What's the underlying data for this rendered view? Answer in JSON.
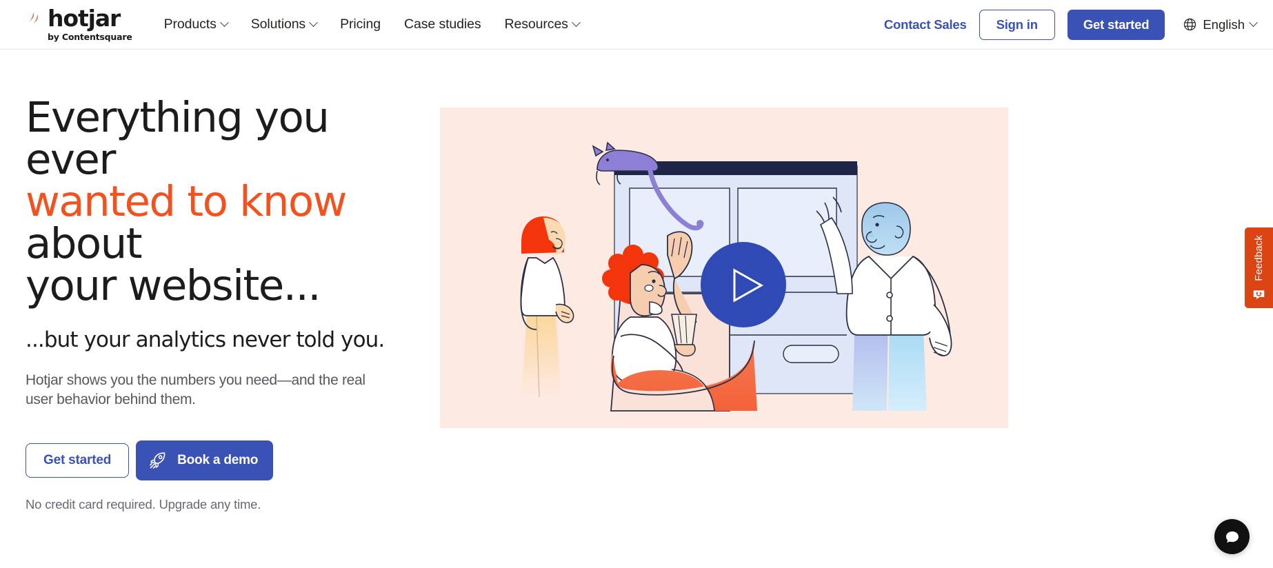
{
  "header": {
    "logo": {
      "icon": "hotjar-flame-icon",
      "wordmark": "hotjar",
      "byline": "by Contentsquare"
    },
    "nav": [
      {
        "label": "Products",
        "has_caret": true,
        "icon": "chevron-down-icon"
      },
      {
        "label": "Solutions",
        "has_caret": true,
        "icon": "chevron-down-icon"
      },
      {
        "label": "Pricing",
        "has_caret": false
      },
      {
        "label": "Case studies",
        "has_caret": false
      },
      {
        "label": "Resources",
        "has_caret": true,
        "icon": "chevron-down-icon"
      }
    ],
    "contact_sales": "Contact Sales",
    "sign_in": "Sign in",
    "get_started": "Get started",
    "language": {
      "label": "English",
      "globe_icon": "globe-icon",
      "caret_icon": "chevron-down-icon"
    }
  },
  "hero": {
    "headline_line1": "Everything you ever",
    "headline_accent": "wanted to know",
    "headline_line2_rest": " about",
    "headline_line3": "your website...",
    "subheadline": "...but your analytics never told you.",
    "body": "Hotjar shows you the numbers you need—and the real user behavior behind them.",
    "cta_primary": "Get started",
    "cta_secondary": "Book a demo",
    "cta_secondary_icon": "rocket-icon",
    "fineprint": "No credit card required. Upgrade any time.",
    "illustration": {
      "alt": "people watching a website on a large screen with a cat on top",
      "play_button_icon": "play-icon",
      "background": "#fdeae2"
    }
  },
  "feedback_tab": {
    "label": "Feedback",
    "icon": "smiley-face-icon",
    "color": "#db4413"
  },
  "chat_widget": {
    "icon": "chat-bubble-icon",
    "color": "#111111"
  },
  "colors": {
    "brand_blue": "#3a52b5",
    "accent_orange": "#f4511e",
    "feedback_red": "#db4413",
    "illustration_bg": "#fdeae2",
    "text_dark": "#1d1c1a",
    "text_muted": "#595661"
  }
}
